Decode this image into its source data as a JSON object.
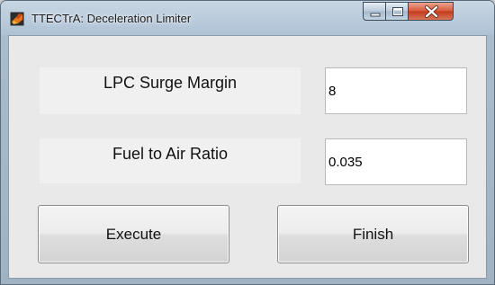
{
  "window": {
    "title": "TTECTrA: Deceleration Limiter",
    "icon": "matlab-icon",
    "controls": [
      "minimize-icon",
      "maximize-icon",
      "close-icon"
    ]
  },
  "form": {
    "rows": [
      {
        "label": "LPC Surge Margin",
        "value": "8"
      },
      {
        "label": "Fuel to Air Ratio",
        "value": "0.035"
      }
    ]
  },
  "buttons": {
    "execute_label": "Execute",
    "finish_label": "Finish"
  },
  "colors": {
    "close_button": "#c94a2c",
    "title_bar": "#b5c7d8",
    "panel": "#e9e9e9"
  }
}
